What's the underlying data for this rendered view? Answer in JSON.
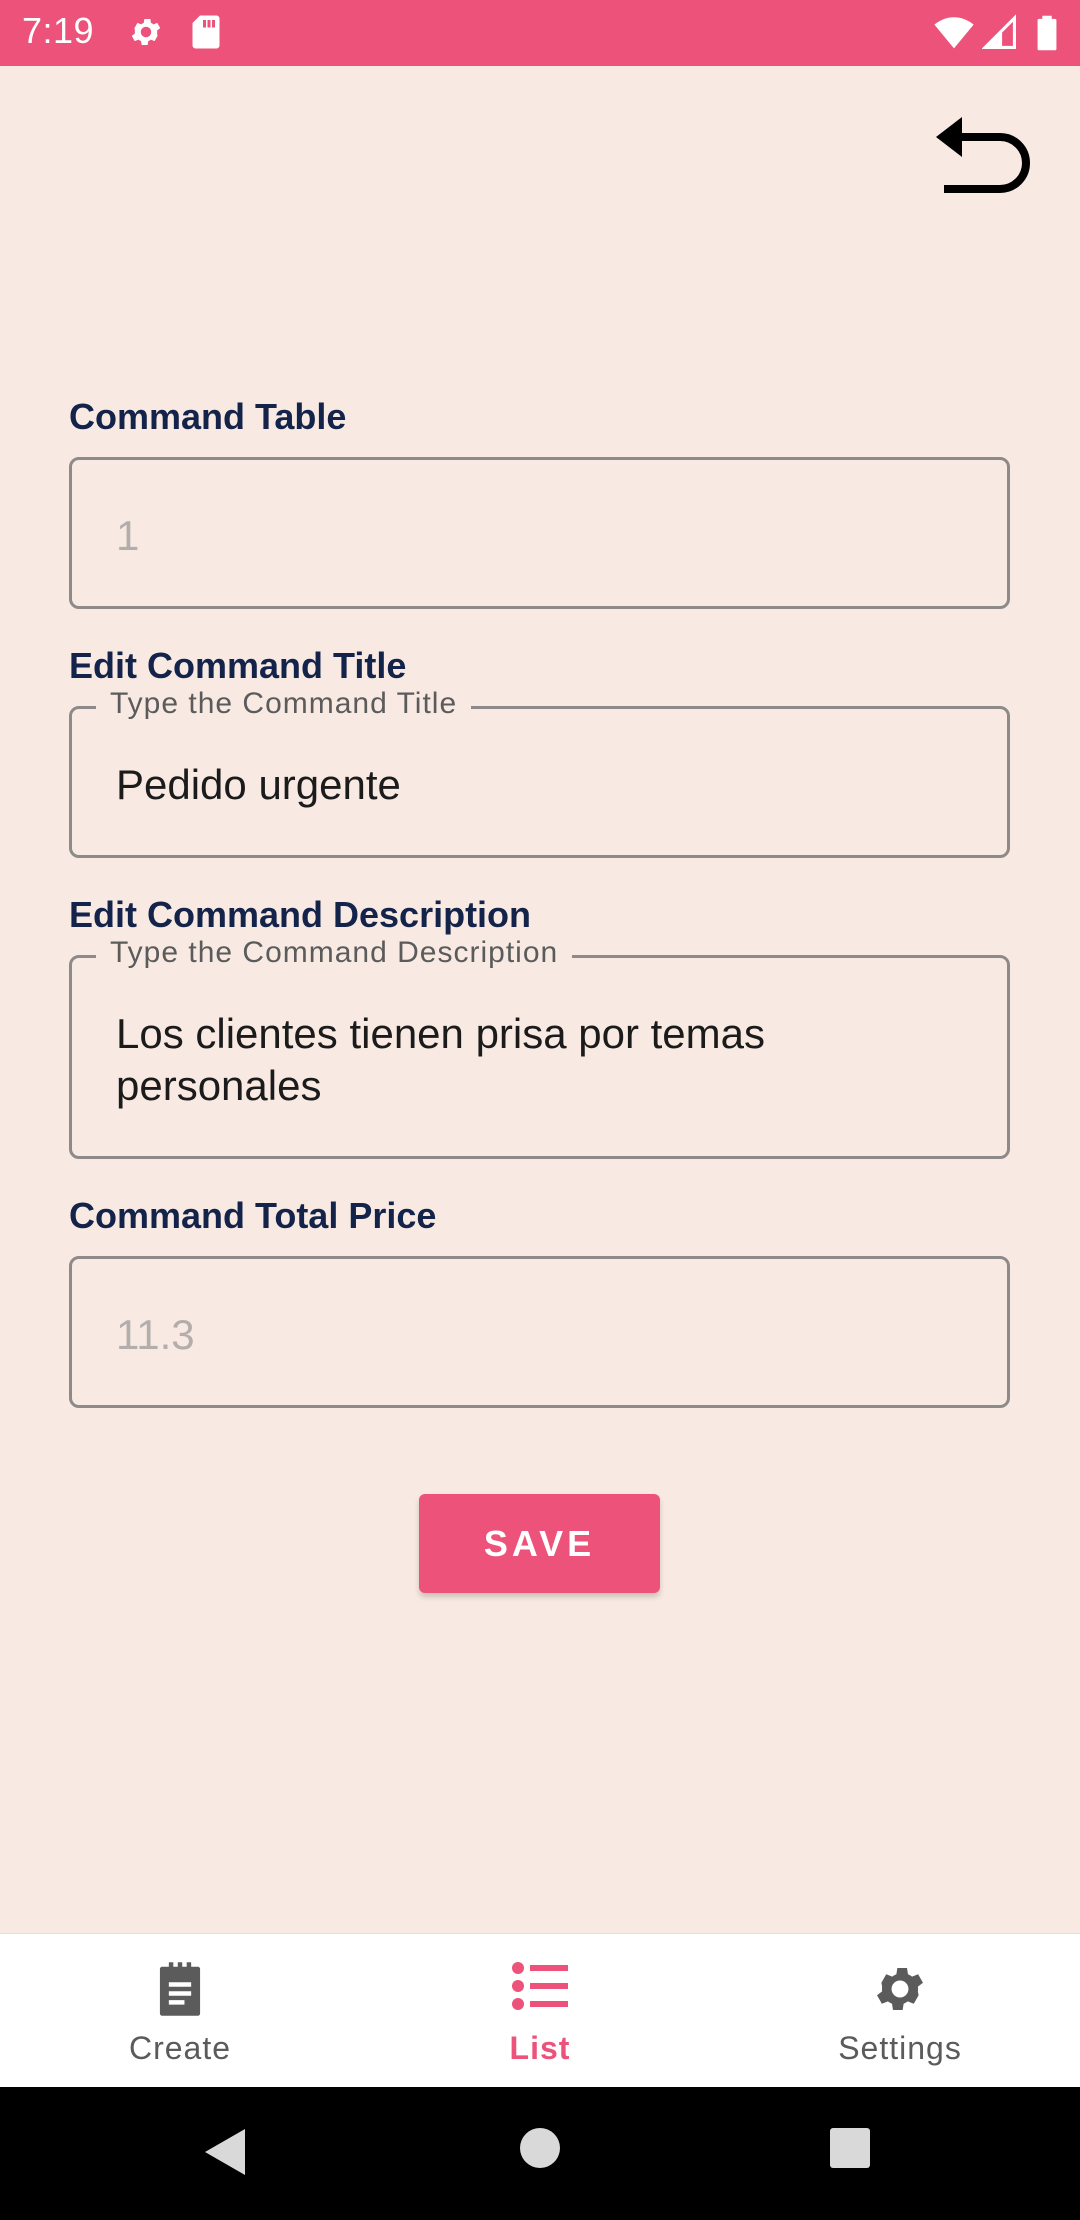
{
  "status_bar": {
    "time": "7:19",
    "icons": [
      "gear-icon",
      "sd-card-icon",
      "wifi-icon",
      "signal-icon",
      "battery-icon"
    ]
  },
  "header": {
    "back_icon": "undo-arrow-icon"
  },
  "form": {
    "table": {
      "label": "Command Table",
      "value": "1"
    },
    "title": {
      "label": "Edit Command Title",
      "legend": "Type the Command Title",
      "value": "Pedido urgente"
    },
    "description": {
      "label": "Edit Command Description",
      "legend": "Type the Command Description",
      "value": "Los clientes tienen prisa por temas personales"
    },
    "price": {
      "label": "Command Total Price",
      "value": "11.3"
    },
    "save_label": "SAVE"
  },
  "bottom_nav": {
    "items": [
      {
        "label": "Create",
        "icon": "notepad-icon",
        "active": false
      },
      {
        "label": "List",
        "icon": "list-icon",
        "active": true
      },
      {
        "label": "Settings",
        "icon": "gear-icon",
        "active": false
      }
    ]
  },
  "colors": {
    "accent": "#EC527A",
    "background": "#F8EAE3",
    "label": "#13234A"
  }
}
